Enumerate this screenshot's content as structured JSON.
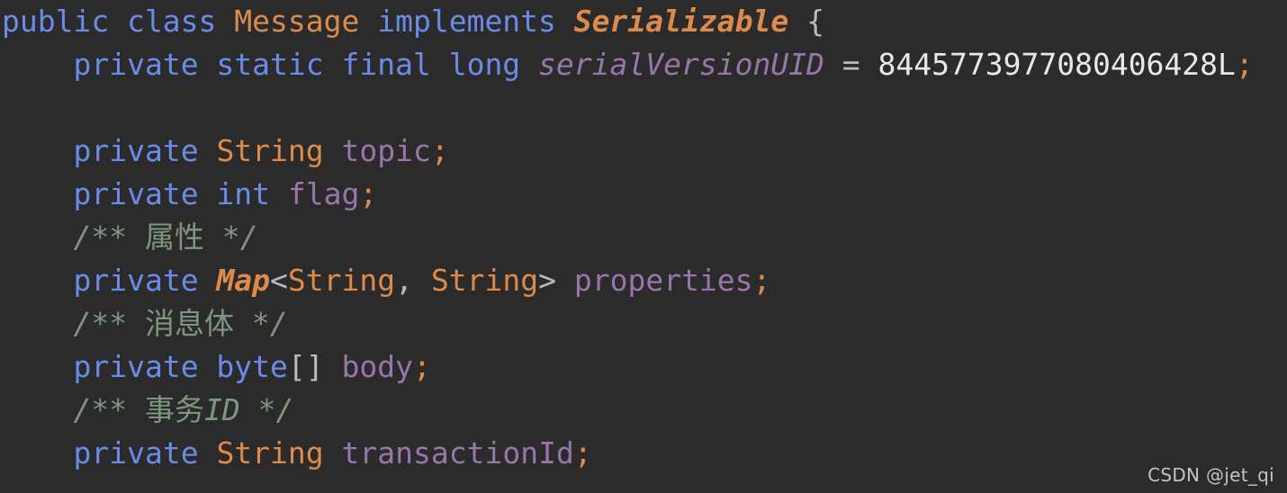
{
  "editor": {
    "background_color": "#2b2b2b",
    "language": "Java",
    "colors": {
      "keyword": "#6a8ce8",
      "class_name": "#dd8a4b",
      "interface_name": "#dd8a4b",
      "field": "#9876aa",
      "static_field": "#9876aa",
      "number": "#e8e8e8",
      "punctuation": "#b6bcc4",
      "semicolon": "#dd8a4b",
      "comment": "#7d967d"
    }
  },
  "code": {
    "lines": [
      {
        "id": "line-class-declaration",
        "tokens": [
          {
            "text": "public class ",
            "type": "keyword"
          },
          {
            "text": "Message",
            "type": "class"
          },
          {
            "text": " ",
            "type": "punct"
          },
          {
            "text": "implements ",
            "type": "keyword"
          },
          {
            "text": "Serializable",
            "type": "interface"
          },
          {
            "text": " {",
            "type": "punct"
          }
        ]
      },
      {
        "id": "line-serial-version-uid",
        "tokens": [
          {
            "text": "    ",
            "type": "punct"
          },
          {
            "text": "private static final long ",
            "type": "keyword"
          },
          {
            "text": "serialVersionUID",
            "type": "static"
          },
          {
            "text": " = ",
            "type": "punct"
          },
          {
            "text": "8445773977080406428L",
            "type": "number"
          },
          {
            "text": ";",
            "type": "semi"
          }
        ]
      },
      {
        "id": "line-blank-1",
        "tokens": []
      },
      {
        "id": "line-field-topic",
        "tokens": [
          {
            "text": "    ",
            "type": "punct"
          },
          {
            "text": "private ",
            "type": "keyword"
          },
          {
            "text": "String",
            "type": "class"
          },
          {
            "text": " ",
            "type": "punct"
          },
          {
            "text": "topic",
            "type": "field"
          },
          {
            "text": ";",
            "type": "semi"
          }
        ]
      },
      {
        "id": "line-field-flag",
        "tokens": [
          {
            "text": "    ",
            "type": "punct"
          },
          {
            "text": "private int ",
            "type": "keyword"
          },
          {
            "text": "flag",
            "type": "field"
          },
          {
            "text": ";",
            "type": "semi"
          }
        ]
      },
      {
        "id": "line-comment-properties",
        "tokens": [
          {
            "text": "    ",
            "type": "punct"
          },
          {
            "text": "/** ",
            "type": "comment"
          },
          {
            "text": "属性",
            "type": "comment-cjk"
          },
          {
            "text": " */",
            "type": "comment"
          }
        ]
      },
      {
        "id": "line-field-properties",
        "tokens": [
          {
            "text": "    ",
            "type": "punct"
          },
          {
            "text": "private ",
            "type": "keyword"
          },
          {
            "text": "Map",
            "type": "interface"
          },
          {
            "text": "<",
            "type": "punct"
          },
          {
            "text": "String",
            "type": "class"
          },
          {
            "text": ", ",
            "type": "punct"
          },
          {
            "text": "String",
            "type": "class"
          },
          {
            "text": "> ",
            "type": "punct"
          },
          {
            "text": "properties",
            "type": "field"
          },
          {
            "text": ";",
            "type": "semi"
          }
        ]
      },
      {
        "id": "line-comment-body",
        "tokens": [
          {
            "text": "    ",
            "type": "punct"
          },
          {
            "text": "/** ",
            "type": "comment"
          },
          {
            "text": "消息体",
            "type": "comment-cjk"
          },
          {
            "text": " */",
            "type": "comment"
          }
        ]
      },
      {
        "id": "line-field-body",
        "tokens": [
          {
            "text": "    ",
            "type": "punct"
          },
          {
            "text": "private byte",
            "type": "keyword"
          },
          {
            "text": "[] ",
            "type": "punct"
          },
          {
            "text": "body",
            "type": "field"
          },
          {
            "text": ";",
            "type": "semi"
          }
        ]
      },
      {
        "id": "line-comment-transaction-id",
        "tokens": [
          {
            "text": "    ",
            "type": "punct"
          },
          {
            "text": "/** ",
            "type": "comment"
          },
          {
            "text": "事务",
            "type": "comment-cjk"
          },
          {
            "text": "ID",
            "type": "comment"
          },
          {
            "text": " */",
            "type": "comment"
          }
        ]
      },
      {
        "id": "line-field-transaction-id",
        "tokens": [
          {
            "text": "    ",
            "type": "punct"
          },
          {
            "text": "private ",
            "type": "keyword"
          },
          {
            "text": "String",
            "type": "class"
          },
          {
            "text": " ",
            "type": "punct"
          },
          {
            "text": "transactionId",
            "type": "field"
          },
          {
            "text": ";",
            "type": "semi"
          }
        ]
      }
    ]
  },
  "watermark": {
    "text": "CSDN @jet_qi"
  }
}
